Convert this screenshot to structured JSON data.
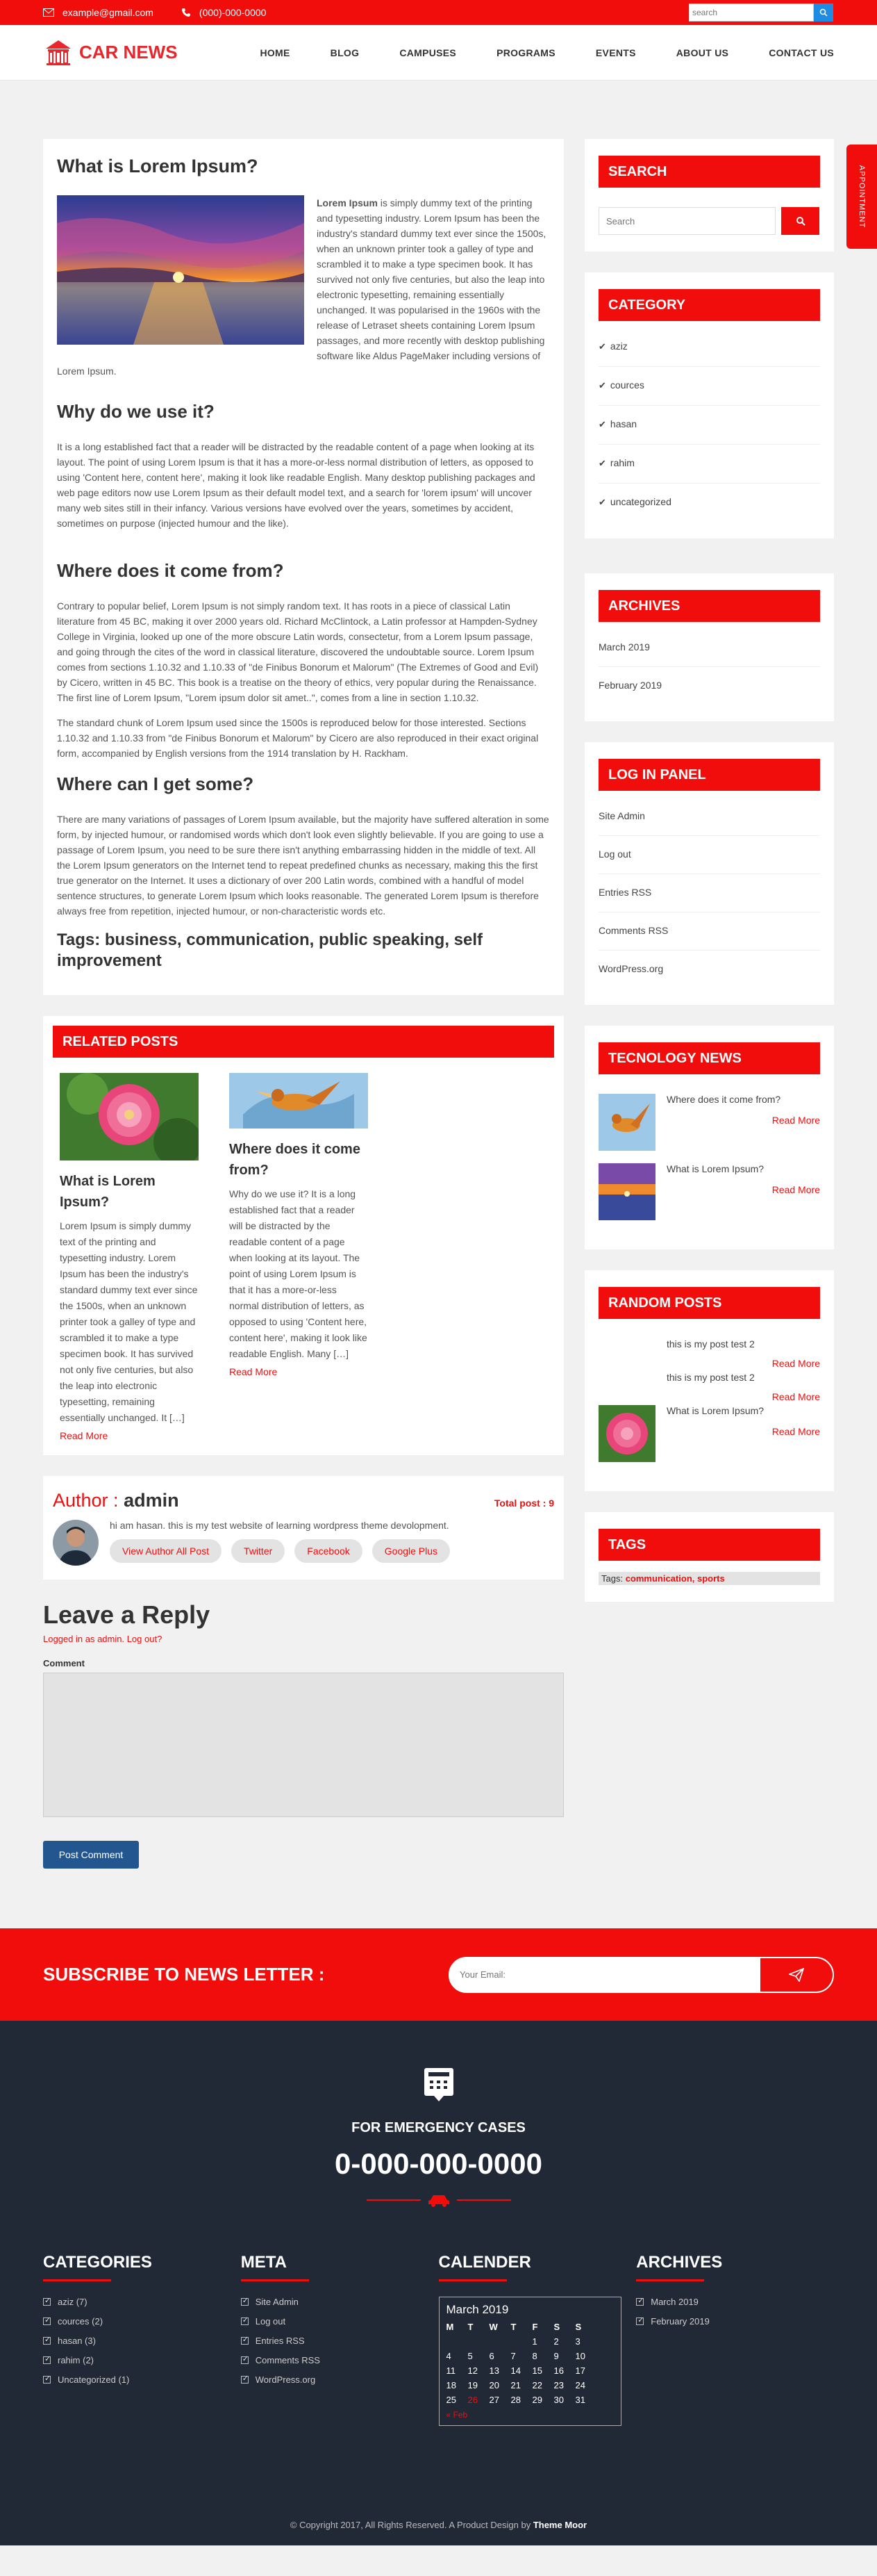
{
  "topbar": {
    "email": "example@gmail.com",
    "phone": "(000)-000-0000",
    "search_placeholder": "search"
  },
  "logo": {
    "text": "CAR NEWS"
  },
  "nav": [
    "HOME",
    "BLOG",
    "CAMPUSES",
    "PROGRAMS",
    "EVENTS",
    "ABOUT US",
    "CONTACT US"
  ],
  "appointment": "APPOINTMENT",
  "post": {
    "title": "What is Lorem Ipsum?",
    "intro_bold": "Lorem Ipsum",
    "intro": " is simply dummy text of the printing and typesetting industry. Lorem Ipsum has been the industry's standard dummy text ever since the 1500s, when an unknown printer took a galley of type and scrambled it to make a type specimen book. It has survived not only five centuries, but also the leap into electronic typesetting, remaining essentially unchanged. It was popularised in the 1960s with the release of Letraset sheets containing Lorem Ipsum passages, and more recently with desktop publishing software like Aldus PageMaker including versions of Lorem Ipsum.",
    "h2a": "Why do we use it?",
    "pa": "It is a long established fact that a reader will be distracted by the readable content of a page when looking at its layout. The point of using Lorem Ipsum is that it has a more-or-less normal distribution of letters, as opposed to using 'Content here, content here', making it look like readable English. Many desktop publishing packages and web page editors now use Lorem Ipsum as their default model text, and a search for 'lorem ipsum' will uncover many web sites still in their infancy. Various versions have evolved over the years, sometimes by accident, sometimes on purpose (injected humour and the like).",
    "h2b": "Where does it come from?",
    "pb1": "Contrary to popular belief, Lorem Ipsum is not simply random text. It has roots in a piece of classical Latin literature from 45 BC, making it over 2000 years old. Richard McClintock, a Latin professor at Hampden-Sydney College in Virginia, looked up one of the more obscure Latin words, consectetur, from a Lorem Ipsum passage, and going through the cites of the word in classical literature, discovered the undoubtable source. Lorem Ipsum comes from sections 1.10.32 and 1.10.33 of \"de Finibus Bonorum et Malorum\" (The Extremes of Good and Evil) by Cicero, written in 45 BC. This book is a treatise on the theory of ethics, very popular during the Renaissance. The first line of Lorem Ipsum, \"Lorem ipsum dolor sit amet..\", comes from a line in section 1.10.32.",
    "pb2": "The standard chunk of Lorem Ipsum used since the 1500s is reproduced below for those interested. Sections 1.10.32 and 1.10.33 from \"de Finibus Bonorum et Malorum\" by Cicero are also reproduced in their exact original form, accompanied by English versions from the 1914 translation by H. Rackham.",
    "h2c": "Where can I get some?",
    "pc": "There are many variations of passages of Lorem Ipsum available, but the majority have suffered alteration in some form, by injected humour, or randomised words which don't look even slightly believable. If you are going to use a passage of Lorem Ipsum, you need to be sure there isn't anything embarrassing hidden in the middle of text. All the Lorem Ipsum generators on the Internet tend to repeat predefined chunks as necessary, making this the first true generator on the Internet. It uses a dictionary of over 200 Latin words, combined with a handful of model sentence structures, to generate Lorem Ipsum which looks reasonable. The generated Lorem Ipsum is therefore always free from repetition, injected humour, or non-characteristic words etc.",
    "tags": "Tags: business, communication, public speaking, self improvement"
  },
  "related": {
    "title": "RELATED POSTS",
    "items": [
      {
        "title": "What is Lorem Ipsum?",
        "text": "Lorem Ipsum is simply dummy text of the printing and typesetting industry. Lorem Ipsum has been the industry's standard dummy text ever since the 1500s, when an unknown printer took a galley of type and scrambled it to make a type specimen book. It has survived not only five centuries, but also the leap into electronic typesetting, remaining essentially unchanged. It […]",
        "more": "Read More"
      },
      {
        "title": "Where does it come from?",
        "text": "Why do we use it? It is a long established fact that a reader will be distracted by the readable content of a page when looking at its layout. The point of using Lorem Ipsum is that it has a more-or-less normal distribution of letters, as opposed to using 'Content here, content here', making it look like readable English. Many […]",
        "more": "Read More"
      }
    ]
  },
  "author": {
    "label": "Author : ",
    "name": "admin",
    "total": "Total post : 9",
    "bio": "hi am hasan. this is my test website of learning wordpress theme devolopment.",
    "buttons": [
      "View Author All Post",
      "Twitter",
      "Facebook",
      "Google Plus"
    ]
  },
  "reply": {
    "title": "Leave a Reply",
    "logged": "Logged in as admin. Log out?",
    "comment_label": "Comment",
    "submit": "Post Comment"
  },
  "sidebar": {
    "search": {
      "title": "SEARCH",
      "placeholder": "Search"
    },
    "category": {
      "title": "CATEGORY",
      "items": [
        "aziz",
        "cources",
        "hasan",
        "rahim",
        "uncategorized"
      ]
    },
    "archives": {
      "title": "ARCHIVES",
      "items": [
        "March 2019",
        "February 2019"
      ]
    },
    "login": {
      "title": "LOG IN PANEL",
      "items": [
        "Site Admin",
        "Log out",
        "Entries RSS",
        "Comments RSS",
        "WordPress.org"
      ]
    },
    "tech": {
      "title": "TECNOLOGY NEWS",
      "items": [
        {
          "title": "Where does it come from?",
          "more": "Read More"
        },
        {
          "title": "What is Lorem Ipsum?",
          "more": "Read More"
        }
      ]
    },
    "random": {
      "title": "RANDOM POSTS",
      "items": [
        {
          "title": "this is my post test 2",
          "more": "Read More"
        },
        {
          "title": "this is my post test 2",
          "more": "Read More"
        },
        {
          "title": "What is Lorem Ipsum?",
          "more": "Read More"
        }
      ]
    },
    "tags": {
      "title": "TAGS",
      "label": "Tags:",
      "values": "communication, sports"
    }
  },
  "subscribe": {
    "title": "SUBSCRIBE TO NEWS LETTER :",
    "placeholder": "Your Email:"
  },
  "footer": {
    "emergency_title": "FOR EMERGENCY CASES",
    "phone": "0-000-000-0000",
    "categories": {
      "title": "CATEGORIES",
      "items": [
        "aziz (7)",
        "cources (2)",
        "hasan (3)",
        "rahim (2)",
        "Uncategorized (1)"
      ]
    },
    "meta": {
      "title": "META",
      "items": [
        "Site Admin",
        "Log out",
        "Entries RSS",
        "Comments RSS",
        "WordPress.org"
      ]
    },
    "calendar": {
      "title": "CALENDER",
      "month": "March 2019",
      "days": [
        "M",
        "T",
        "W",
        "T",
        "F",
        "S",
        "S"
      ],
      "weeks": [
        [
          "",
          "",
          "",
          "",
          "1",
          "2",
          "3"
        ],
        [
          "4",
          "5",
          "6",
          "7",
          "8",
          "9",
          "10"
        ],
        [
          "11",
          "12",
          "13",
          "14",
          "15",
          "16",
          "17"
        ],
        [
          "18",
          "19",
          "20",
          "21",
          "22",
          "23",
          "24"
        ],
        [
          "25",
          "26",
          "27",
          "28",
          "29",
          "30",
          "31"
        ]
      ],
      "prev": "« Feb"
    },
    "archives": {
      "title": "ARCHIVES",
      "items": [
        "March 2019",
        "February 2019"
      ]
    },
    "copyright": "© Copyright 2017, All Rights Reserved. A Product Design by ",
    "brand": "Theme Moor"
  }
}
